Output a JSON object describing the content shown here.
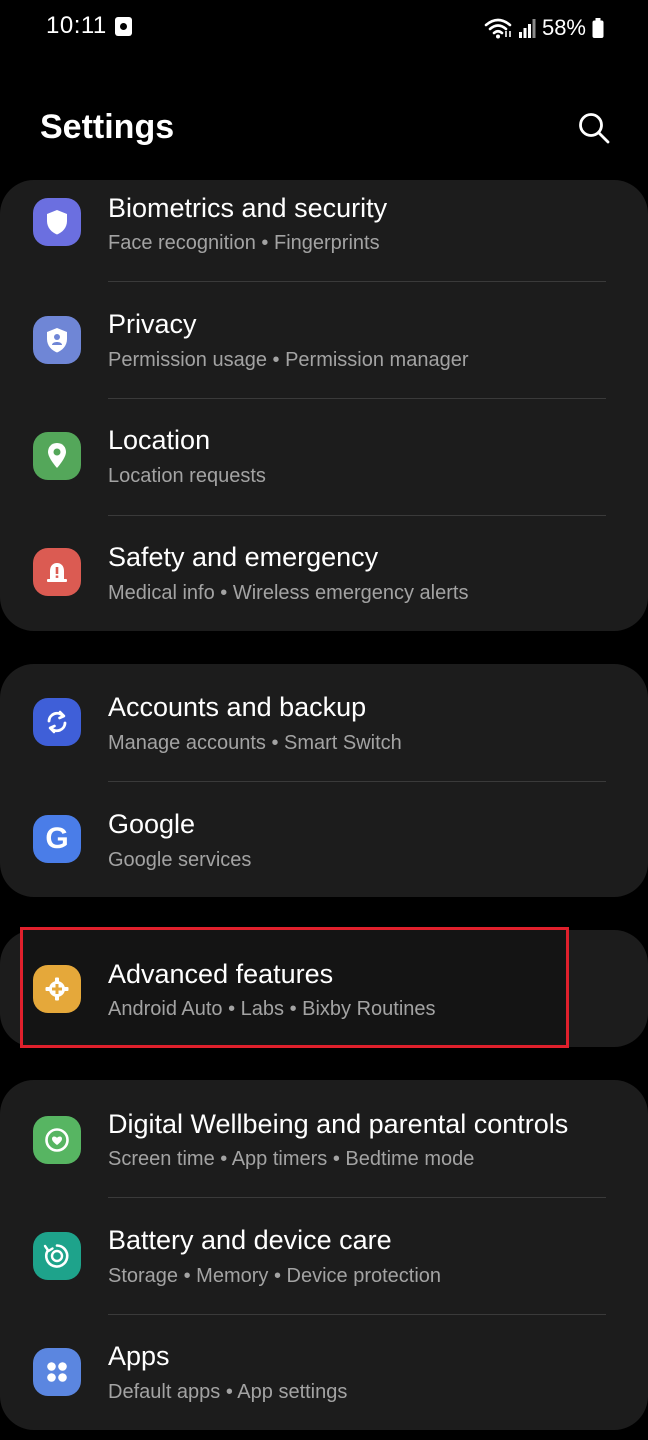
{
  "status_bar": {
    "time": "10:11",
    "battery": "58%"
  },
  "header": {
    "title": "Settings"
  },
  "groups": [
    {
      "items": [
        {
          "title": "Biometrics and security",
          "subtitle": "Face recognition  •  Fingerprints",
          "icon": "shield-icon",
          "color": "#6b6fe0"
        },
        {
          "title": "Privacy",
          "subtitle": "Permission usage  •  Permission manager",
          "icon": "privacy-shield-icon",
          "color": "#6f86d6"
        },
        {
          "title": "Location",
          "subtitle": "Location requests",
          "icon": "location-pin-icon",
          "color": "#54a75a"
        },
        {
          "title": "Safety and emergency",
          "subtitle": "Medical info  •  Wireless emergency alerts",
          "icon": "siren-icon",
          "color": "#db5b52"
        }
      ]
    },
    {
      "items": [
        {
          "title": "Accounts and backup",
          "subtitle": "Manage accounts  •  Smart Switch",
          "icon": "sync-icon",
          "color": "#3f5fd8"
        },
        {
          "title": "Google",
          "subtitle": "Google services",
          "icon": "google-g-icon",
          "color": "#4a7de8"
        }
      ]
    },
    {
      "items": [
        {
          "title": "Advanced features",
          "subtitle": "Android Auto  •  Labs  •  Bixby Routines",
          "icon": "plus-gear-icon",
          "color": "#e5a83a"
        }
      ]
    },
    {
      "items": [
        {
          "title": "Digital Wellbeing and parental controls",
          "subtitle": "Screen time  •  App timers  •  Bedtime mode",
          "icon": "heart-circle-icon",
          "color": "#57b562"
        },
        {
          "title": "Battery and device care",
          "subtitle": "Storage  •  Memory  •  Device protection",
          "icon": "device-care-icon",
          "color": "#1ea38b"
        },
        {
          "title": "Apps",
          "subtitle": "Default apps  •  App settings",
          "icon": "apps-grid-icon",
          "color": "#5b86e0"
        }
      ]
    }
  ],
  "highlight_color": "#e0202c"
}
